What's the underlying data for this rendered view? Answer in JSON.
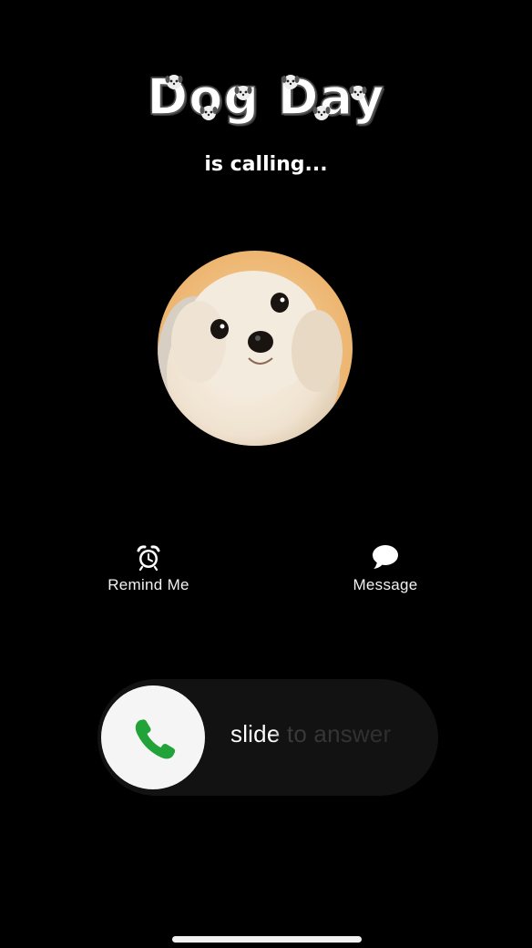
{
  "caller": {
    "name": "Dog Day",
    "status": "is calling..."
  },
  "actions": {
    "remind": {
      "label": "Remind Me",
      "icon": "alarm-clock-icon"
    },
    "message": {
      "label": "Message",
      "icon": "message-bubble-icon"
    }
  },
  "slider": {
    "text": "slide to answer",
    "icon": "phone-icon",
    "icon_color": "#22a33a"
  },
  "colors": {
    "background": "#000000",
    "text": "#ffffff",
    "answer_green": "#22a33a"
  }
}
